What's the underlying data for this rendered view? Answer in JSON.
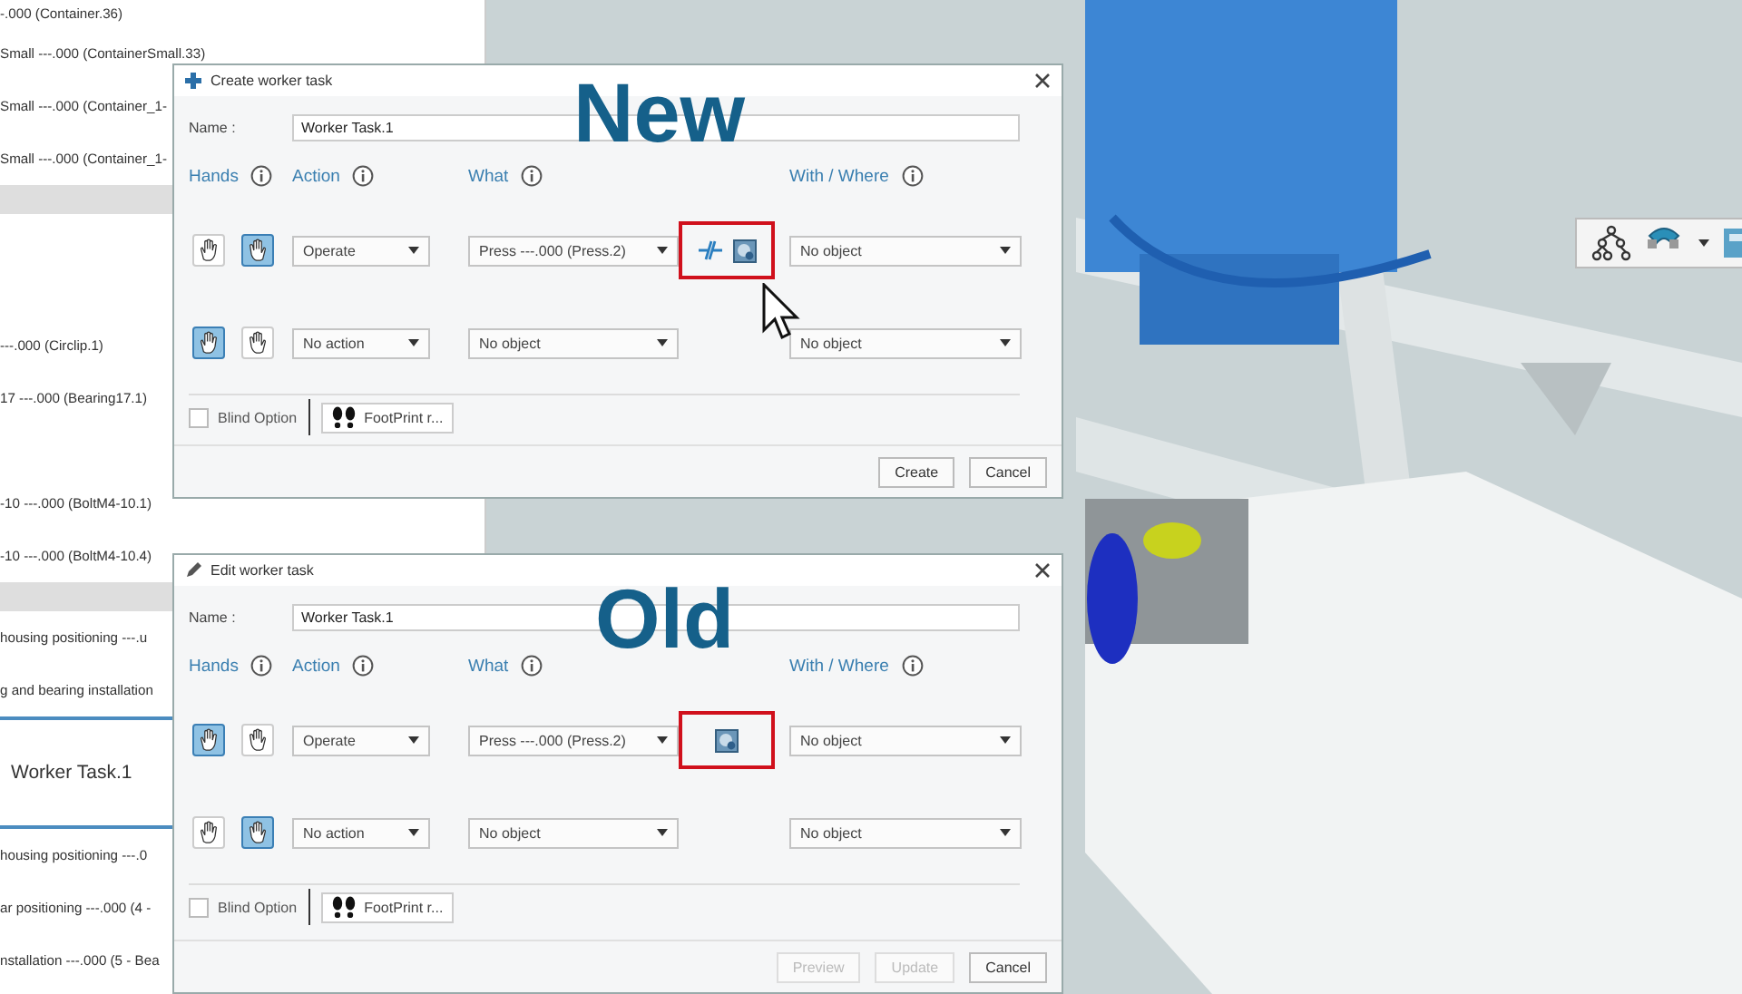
{
  "tree": {
    "items": [
      {
        "kind": "item",
        "text": "-.000 (Container.36)",
        "selected": false
      },
      {
        "kind": "item",
        "text": "Small ---.000 (ContainerSmall.33)",
        "selected": false
      },
      {
        "kind": "item",
        "text": "Small ---.000 (Container_1-",
        "selected": false
      },
      {
        "kind": "item",
        "text": "Small ---.000 (Container_1-",
        "selected": false
      },
      {
        "kind": "header"
      },
      {
        "kind": "blank"
      },
      {
        "kind": "blank"
      },
      {
        "kind": "item",
        "text": "---.000 (Circlip.1)",
        "selected": false
      },
      {
        "kind": "item",
        "text": "17 ---.000 (Bearing17.1)",
        "selected": false
      },
      {
        "kind": "blank"
      },
      {
        "kind": "item",
        "text": "-10 ---.000 (BoltM4-10.1)",
        "selected": false
      },
      {
        "kind": "item",
        "text": "-10 ---.000 (BoltM4-10.4)",
        "selected": false
      },
      {
        "kind": "header"
      },
      {
        "kind": "item",
        "text": "housing positioning ---.u",
        "selected": false
      },
      {
        "kind": "item",
        "text": "g and bearing installation",
        "selected": false
      },
      {
        "kind": "item",
        "text": "Worker Task.1",
        "selected": true
      },
      {
        "kind": "item",
        "text": "housing positioning ---.0",
        "selected": false
      },
      {
        "kind": "item",
        "text": "ar positioning ---.000 (4 -",
        "selected": false
      },
      {
        "kind": "item",
        "text": "nstallation ---.000 (5 - Bea",
        "selected": false
      }
    ]
  },
  "dialogs": [
    {
      "kind": "create",
      "title": "Create worker task",
      "overlay_label": "New",
      "name_label": "Name :",
      "name_value": "Worker Task.1",
      "headers": [
        {
          "label": "Hands"
        },
        {
          "label": "Action"
        },
        {
          "label": "What"
        },
        {
          "label": "With / Where"
        }
      ],
      "task_rows": [
        {
          "hands": [
            {
              "selected": false
            },
            {
              "selected": true
            }
          ],
          "action": "Operate",
          "what": "Press ---.000 (Press.2)",
          "with": "No object",
          "tools_highlighted": true,
          "tools": [
            {
              "kind": "split"
            },
            {
              "kind": "part"
            }
          ]
        },
        {
          "hands": [
            {
              "selected": true
            },
            {
              "selected": false
            }
          ],
          "action": "No action",
          "what": "No object",
          "with": "No object",
          "tools_highlighted": false,
          "tools": []
        }
      ],
      "blind_option": {
        "label": "Blind Option",
        "checked": false
      },
      "footprint_button": "FootPrint r...",
      "buttons": [
        {
          "label": "Create",
          "disabled": false
        },
        {
          "label": "Cancel",
          "disabled": false
        }
      ]
    },
    {
      "kind": "edit",
      "title": "Edit worker task",
      "overlay_label": "Old",
      "name_label": "Name :",
      "name_value": "Worker Task.1",
      "headers": [
        {
          "label": "Hands"
        },
        {
          "label": "Action"
        },
        {
          "label": "What"
        },
        {
          "label": "With / Where"
        }
      ],
      "task_rows": [
        {
          "hands": [
            {
              "selected": true
            },
            {
              "selected": false
            }
          ],
          "action": "Operate",
          "what": "Press ---.000 (Press.2)",
          "with": "No object",
          "tools_highlighted": true,
          "tools": [
            {
              "kind": "part"
            }
          ]
        },
        {
          "hands": [
            {
              "selected": false
            },
            {
              "selected": true
            }
          ],
          "action": "No action",
          "what": "No object",
          "with": "No object",
          "tools_highlighted": false,
          "tools": []
        }
      ],
      "blind_option": {
        "label": "Blind Option",
        "checked": false
      },
      "footprint_button": "FootPrint r...",
      "buttons": [
        {
          "label": "Preview",
          "disabled": true
        },
        {
          "label": "Update",
          "disabled": true
        },
        {
          "label": "Cancel",
          "disabled": false
        }
      ]
    }
  ]
}
